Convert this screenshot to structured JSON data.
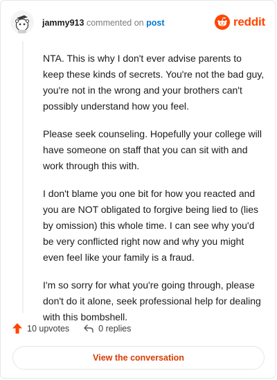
{
  "header": {
    "username": "jammy913",
    "action_text": "commented on",
    "post_link": "post",
    "brand": "reddit"
  },
  "comment": {
    "paragraphs": [
      "NTA. This is why I don't ever advise parents to keep these kinds of secrets. You're not the bad guy, you're not in the wrong and your brothers can't possibly understand how you feel.",
      "Please seek counseling. Hopefully your college will have someone on staff that you can sit with and work through this with.",
      "I don't blame you one bit for how you reacted and you are NOT obligated to forgive being lied to (lies by omission) this whole time. I can see why you'd be very conflicted right now and why you might even feel like your family is a fraud.",
      "I'm so sorry for what you're going through, please don't do it alone, seek professional help for dealing with this bombshell."
    ]
  },
  "actions": {
    "upvotes": "10 upvotes",
    "replies": "0 replies"
  },
  "footer": {
    "view_label": "View the conversation"
  },
  "colors": {
    "brand": "#ff4500",
    "link": "#0079d3",
    "button_text": "#d93a00"
  },
  "icons": {
    "avatar": "snoo-avatar",
    "brand": "reddit-logo-icon",
    "upvote": "upvote-arrow-icon",
    "reply": "reply-icon"
  }
}
